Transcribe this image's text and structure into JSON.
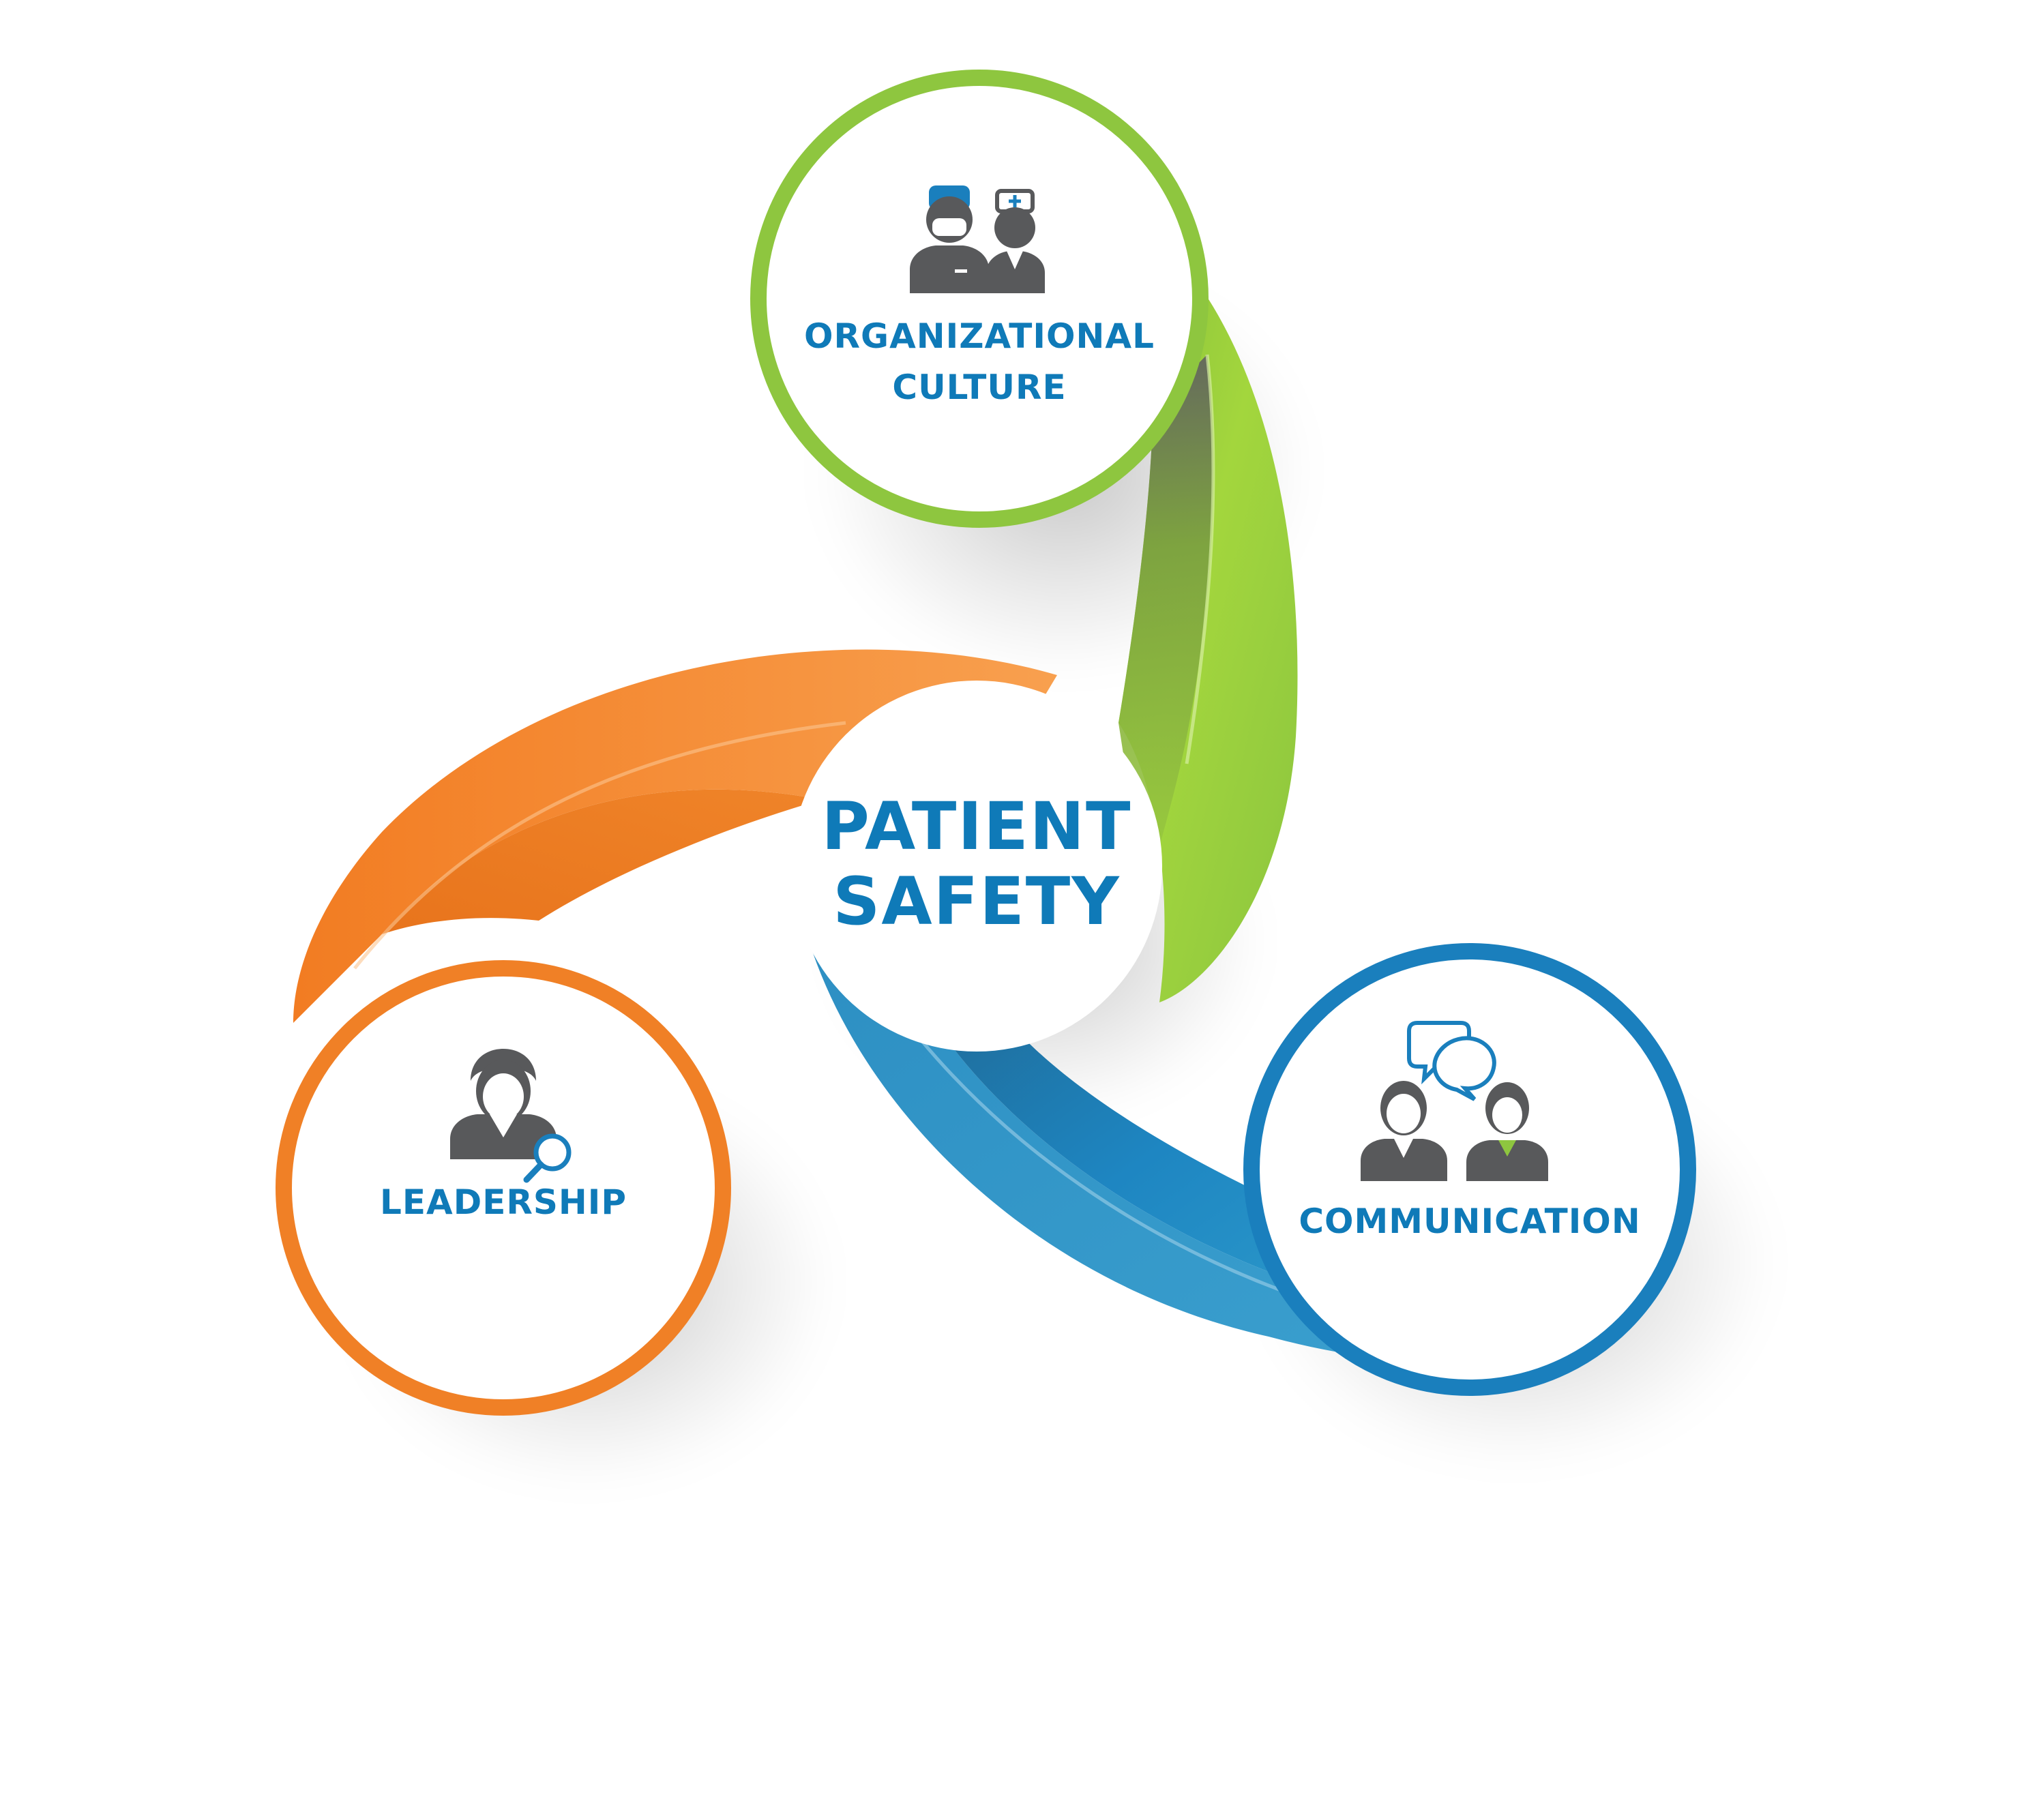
{
  "center": {
    "line1": "PATIENT",
    "line2": "SAFETY"
  },
  "nodes": [
    {
      "id": "organizational-culture",
      "line1": "ORGANIZATIONAL",
      "line2": "CULTURE",
      "icon": "surgeon-and-nurse-icon",
      "ring_color": "#8ec63f"
    },
    {
      "id": "leadership",
      "line1": "LEADERSHIP",
      "icon": "doctor-with-magnifier-icon",
      "ring_color": "#f08026"
    },
    {
      "id": "communication",
      "line1": "COMMUNICATION",
      "icon": "doctors-with-speech-bubbles-icon",
      "ring_color": "#1a7fbd"
    }
  ],
  "colors": {
    "text": "#0f7ab8",
    "icon_gray": "#58595b",
    "green": "#8ec63f",
    "orange": "#f08026",
    "blue": "#1a7fbd"
  }
}
